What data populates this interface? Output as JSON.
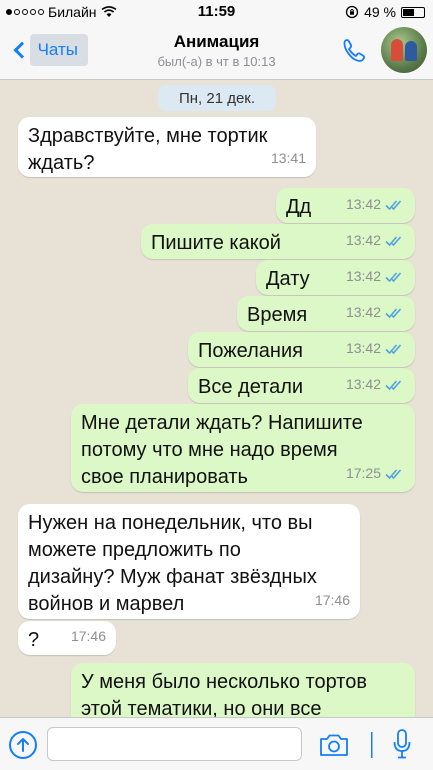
{
  "status_bar": {
    "carrier": "Билайн",
    "time": "11:59",
    "battery_text": "49 %",
    "battery_level": 0.49
  },
  "header": {
    "back_label": "Чаты",
    "title": "Анимация",
    "subtitle": "был(-а) в чт в 10:13"
  },
  "chat": {
    "date": "Пн, 21 дек.",
    "messages": [
      {
        "dir": "in",
        "text": "Здравствуйте, мне тортик\nждать?",
        "time": "13:41"
      },
      {
        "dir": "out",
        "text": "Дд",
        "time": "13:42"
      },
      {
        "dir": "out",
        "text": "Пишите какой",
        "time": "13:42"
      },
      {
        "dir": "out",
        "text": "Дату",
        "time": "13:42"
      },
      {
        "dir": "out",
        "text": "Время",
        "time": "13:42"
      },
      {
        "dir": "out",
        "text": "Пожелания",
        "time": "13:42"
      },
      {
        "dir": "out",
        "text": "Все детали",
        "time": "13:42"
      },
      {
        "dir": "out",
        "text": "Мне детали ждать? Напишите\nпотому что мне надо время\nсвое планировать",
        "time": "17:25"
      },
      {
        "dir": "in",
        "text": "Нужен на понедельник, что вы\nможете предложить по\nдизайну? Муж фанат звёздных\nвойнов и марвел",
        "time": "17:46"
      },
      {
        "dir": "in",
        "text": "?",
        "time": "17:46"
      },
      {
        "dir": "out",
        "text": "У меня было несколько тортов\nэтой тематики, но они все",
        "time": ""
      }
    ]
  },
  "input": {
    "placeholder": ""
  },
  "icons": {
    "wifi": "wifi-icon",
    "lock": "orientation-lock-icon",
    "call": "phone-icon",
    "share": "share-arrow-icon",
    "camera": "camera-icon",
    "mic": "microphone-icon",
    "read": "double-check-icon"
  },
  "colors": {
    "accent": "#147efb",
    "outgoing_bubble": "#dcf8c6",
    "incoming_bubble": "#ffffff",
    "read_ticks": "#4fa3e0",
    "chat_background": "#e8e1d6"
  }
}
